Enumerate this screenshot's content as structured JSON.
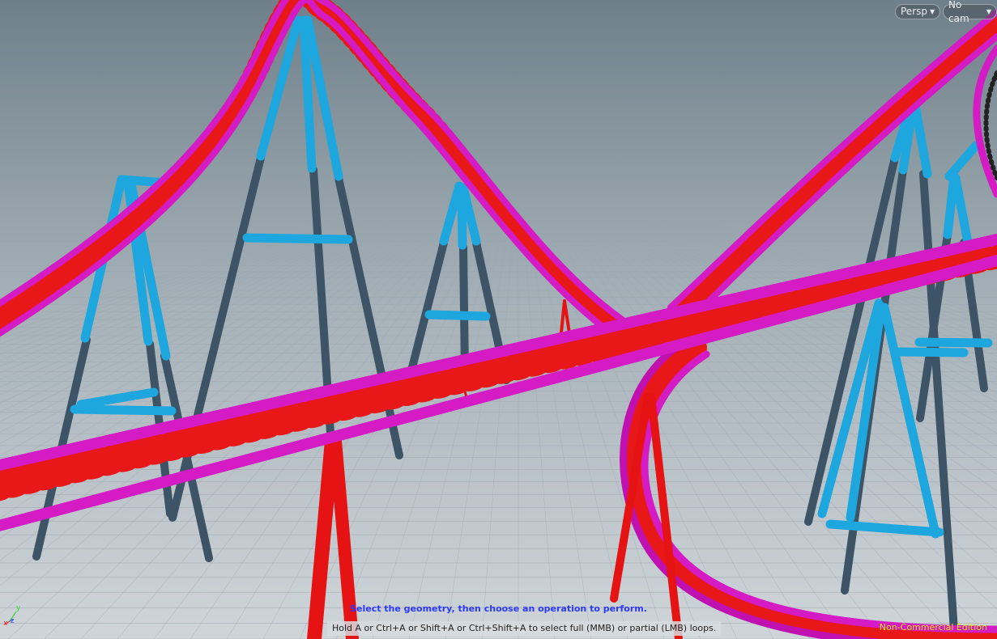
{
  "viewport": {
    "camera_menu": "Persp",
    "cam_menu": "No cam",
    "prompt": "Select the geometry, then choose an operation to perform.",
    "hint": "Hold A or Ctrl+A or Shift+A or Ctrl+Shift+A to select full (MMB) or partial (LMB) loops.",
    "edition": "Non-Commercial Edition",
    "axes": {
      "x": "x",
      "y": "y",
      "z": "z"
    }
  },
  "colors": {
    "track": "#d41bc4",
    "truss": "#e81818",
    "support_upper": "#1ea6df",
    "support_lower": "#3d5366",
    "red_support": "#e51313",
    "sky_top": "#74858f",
    "sky_bottom": "#c7ced3",
    "grid_line": "#9aa4ab",
    "prompt": "#2b38ff",
    "edition": "#e6e600"
  }
}
